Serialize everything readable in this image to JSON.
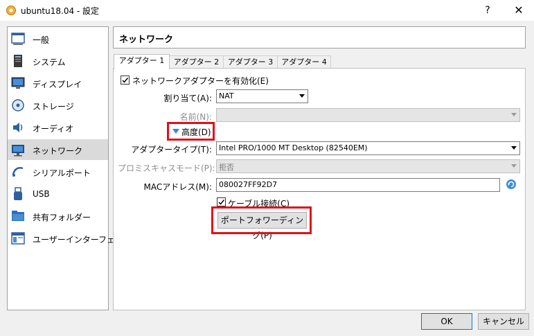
{
  "window": {
    "title": "ubuntu18.04 - 設定",
    "help": "?",
    "close": "✕"
  },
  "sidebar": {
    "items": [
      {
        "label": "一般",
        "icon": "general-icon"
      },
      {
        "label": "システム",
        "icon": "system-icon"
      },
      {
        "label": "ディスプレイ",
        "icon": "display-icon"
      },
      {
        "label": "ストレージ",
        "icon": "storage-icon"
      },
      {
        "label": "オーディオ",
        "icon": "audio-icon"
      },
      {
        "label": "ネットワーク",
        "icon": "network-icon",
        "selected": true
      },
      {
        "label": "シリアルポート",
        "icon": "serial-port-icon"
      },
      {
        "label": "USB",
        "icon": "usb-icon"
      },
      {
        "label": "共有フォルダー",
        "icon": "shared-folder-icon"
      },
      {
        "label": "ユーザーインターフェース",
        "icon": "user-interface-icon"
      }
    ]
  },
  "panel": {
    "title": "ネットワーク",
    "tabs": [
      {
        "label": "アダプター 1",
        "active": true
      },
      {
        "label": "アダプター 2"
      },
      {
        "label": "アダプター 3"
      },
      {
        "label": "アダプター 4"
      }
    ],
    "enable_adapter": {
      "label": "ネットワークアダプターを有効化(E)",
      "checked": true
    },
    "attached_to": {
      "label": "割り当て(A):",
      "value": "NAT"
    },
    "name": {
      "label": "名前(N):",
      "value": ""
    },
    "advanced": {
      "label": "高度(D)",
      "expanded": true
    },
    "adapter_type": {
      "label": "アダプタータイプ(T):",
      "value": "Intel PRO/1000 MT Desktop (82540EM)"
    },
    "promiscuous": {
      "label": "プロミスキャスモード(P):",
      "value": "拒否"
    },
    "mac": {
      "label": "MACアドレス(M):",
      "value": "080027FF92D7"
    },
    "cable_connected": {
      "label": "ケーブル接続(C)",
      "checked": true
    },
    "port_forwarding": {
      "label": "ポートフォワーディング(P)"
    }
  },
  "footer": {
    "ok": "OK",
    "cancel": "キャンセル"
  },
  "colors": {
    "highlight": "#e0101c",
    "accent": "#0078d7",
    "selected_row": "#dadada"
  }
}
